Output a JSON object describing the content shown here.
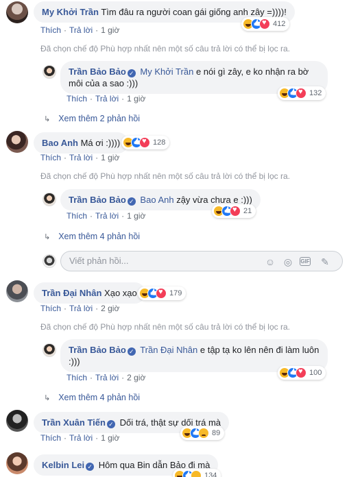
{
  "comments": [
    {
      "author": "My Khởi Trần",
      "text": "Tìm đâu ra người coan gái giống anh zây =))))!",
      "like_label": "Thích",
      "reply_label": "Trả lời",
      "time": "1 giờ",
      "reaction_count": "412",
      "filter_note": "Đã chọn chế độ Phù hợp nhất nên một số câu trả lời có thể bị lọc ra.",
      "reply": {
        "author": "Trần Bảo Bảo",
        "mention": "My Khởi Trần",
        "text": "e nói gì zây, e ko nhận ra bờ môi của a sao :)))",
        "like_label": "Thích",
        "reply_label": "Trả lời",
        "time": "1 giờ",
        "reaction_count": "132"
      },
      "more_replies": "Xem thêm 2 phản hồi"
    },
    {
      "author": "Bao Anh",
      "text": "Má ơi :))))",
      "like_label": "Thích",
      "reply_label": "Trả lời",
      "time": "1 giờ",
      "reaction_count": "128",
      "filter_note": "Đã chọn chế độ Phù hợp nhất nên một số câu trả lời có thể bị lọc ra.",
      "reply": {
        "author": "Trần Bảo Bảo",
        "mention": "Bao Anh",
        "text": "zậy vừa chưa e :)))",
        "like_label": "Thích",
        "reply_label": "Trả lời",
        "time": "1 giờ",
        "reaction_count": "21"
      },
      "more_replies": "Xem thêm 4 phản hồi"
    },
    {
      "author": "Trần Đại Nhân",
      "text": "Xạo xạo",
      "like_label": "Thích",
      "reply_label": "Trả lời",
      "time": "2 giờ",
      "reaction_count": "179",
      "filter_note": "Đã chọn chế độ Phù hợp nhất nên một số câu trả lời có thể bị lọc ra.",
      "reply": {
        "author": "Trần Bảo Bảo",
        "mention": "Trần Đại Nhân",
        "text": "e tập tạ ko lên nên đi làm luôn :)))",
        "like_label": "Thích",
        "reply_label": "Trả lời",
        "time": "2 giờ",
        "reaction_count": "100"
      },
      "more_replies": "Xem thêm 4 phản hồi"
    },
    {
      "author": "Trần Xuân Tiến",
      "text": "Dối trá, thật sự dối trá mà",
      "like_label": "Thích",
      "reply_label": "Trả lời",
      "time": "1 giờ",
      "reaction_count": "89"
    },
    {
      "author": "Kelbin Lei",
      "text": "Hôm qua Bin dẫn Bảo đi mà",
      "reaction_count": "134"
    }
  ],
  "reply_box": {
    "placeholder": "Viết phản hồi...",
    "icons": [
      "emoji-icon",
      "camera-icon",
      "gif-icon",
      "sticker-icon"
    ]
  },
  "icons": {
    "reply_arrow": "↳",
    "verified": "✓",
    "emoji": "☺",
    "camera": "◎",
    "gif": "GIF",
    "sticker": "✎"
  }
}
